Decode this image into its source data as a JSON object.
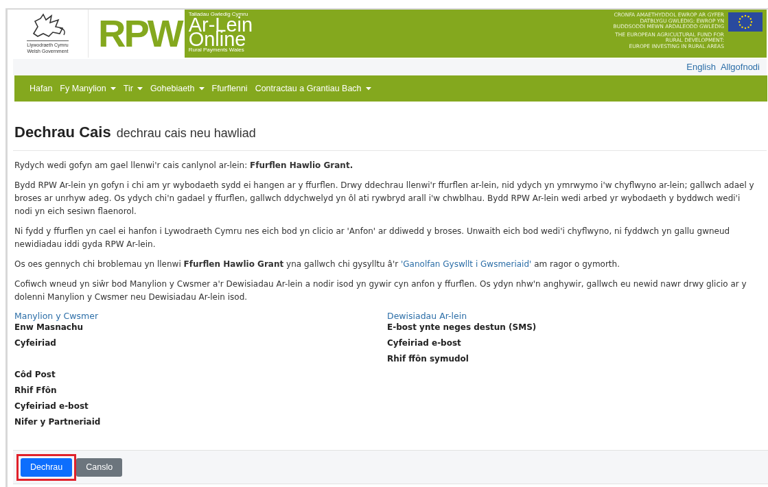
{
  "header": {
    "government_logo": "Llywodraeth Cymru",
    "government_logo_en": "Welsh Government",
    "brand": "RPW",
    "tagline_small": "Taliadau Gwledig Cymru",
    "tagline_line1": "Ar-Lein",
    "tagline_line2": "Online",
    "tagline_sub": "Rural Payments Wales",
    "eu_text_cy": [
      "CRONFA AMAETHYDDOL EWROP AR GYFER",
      "DATBLYGU GWLEDIG: EWROP YN",
      "BUDDSODDI MEWN ARDALEODD GWLEDIG"
    ],
    "eu_text_en": [
      "THE EUROPEAN AGRICULTURAL FUND FOR",
      "RURAL DEVELOPMENT:",
      "EUROPE INVESTING IN RURAL AREAS"
    ]
  },
  "top_links": [
    "English",
    "Allgofnodi"
  ],
  "nav": [
    {
      "label": "Hafan",
      "dropdown": false
    },
    {
      "label": "Fy Manylion",
      "dropdown": true
    },
    {
      "label": "Tir",
      "dropdown": true
    },
    {
      "label": "Gohebiaeth",
      "dropdown": true
    },
    {
      "label": "Ffurflenni",
      "dropdown": false
    },
    {
      "label": "Contractau a Grantiau Bach",
      "dropdown": true
    }
  ],
  "page_title": "Dechrau Cais",
  "page_subtitle": "dechrau cais neu hawliad",
  "paragraphs": [
    {
      "text": "Rydych wedi gofyn am gael llenwi'r cais canlynol ar-lein: **Ffurflen Hawlio Grant.**"
    },
    {
      "text": "Bydd RPW Ar-lein yn gofyn i chi am yr wybodaeth sydd ei hangen ar y ffurflen. Drwy ddechrau llenwi'r ffurflen ar-lein, nid ydych yn ymrwymo i'w chyflwyno ar-lein; gallwch adael y broses ar unrhyw adeg. Os ydych chi'n gadael y ffurflen, gallwch ddychwelyd yn ôl ati rywbryd arall i'w chwblhau. Bydd RPW Ar-lein wedi arbed yr wybodaeth y byddwch wedi'i nodi yn eich sesiwn flaenorol."
    },
    {
      "text": "Ni fydd y ffurflen yn cael ei hanfon i Lywodraeth Cymru nes eich bod yn clicio ar 'Anfon' ar ddiwedd y broses. Unwaith eich bod wedi'i chyflwyno, ni fyddwch yn gallu gwneud newidiadau iddi gyda RPW Ar-lein."
    },
    {
      "text": "Os oes gennych chi broblemau yn llenwi **Ffurflen Hawlio Grant** yna gallwch chi gysylltu â'r ",
      "link": "'Ganolfan Gyswllt i Gwsmeriaid'",
      "after": " am ragor o gymorth."
    },
    {
      "text": "Cofiwch wneud yn siŵr bod Manylion y Cwsmer a'r Dewisiadau Ar-lein a nodir isod yn gywir cyn anfon y ffurflen. Os ydyn nhw'n anghywir, gallwch eu newid nawr drwy glicio ar y dolenni Manylion y Cwsmer neu Dewisiadau Ar-lein isod."
    }
  ],
  "customer_details": {
    "heading": "Manylion y Cwsmer",
    "fields": [
      "Enw Masnachu",
      "Cyfeiriad",
      "Côd Post",
      "Rhif Ffôn",
      "Cyfeiriad e-bost",
      "Nifer y Partneriaid"
    ]
  },
  "online_preferences": {
    "heading": "Dewisiadau Ar-lein",
    "fields": [
      "E-bost ynte neges destun (SMS)",
      "Cyfeiriad e-bost",
      "Rhif ffôn symudol"
    ]
  },
  "buttons": [
    {
      "label": "Dechrau",
      "kind": "primary",
      "highlighted": true
    },
    {
      "label": "Canslo",
      "kind": "secondary",
      "highlighted": false
    }
  ]
}
